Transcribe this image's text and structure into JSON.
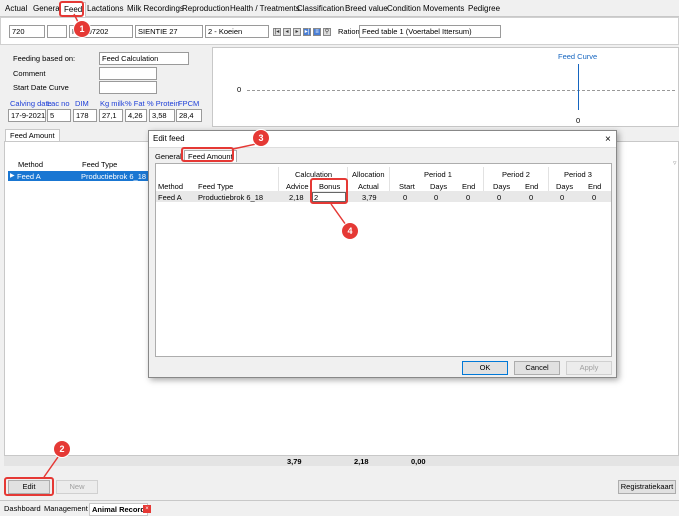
{
  "tabs": [
    "Actual",
    "General",
    "Feed",
    "Lactations",
    "Milk Recordings",
    "Reproduction",
    "Health / Treatments",
    "Classification",
    "Breed value",
    "Condition",
    "Movements",
    "Pedigree"
  ],
  "animal": {
    "number": "720",
    "id": "NL 207202",
    "name": "SIENTIE 27",
    "group": "2 - Koeien",
    "ration_label": "Ration",
    "ration": "Feed table 1 (Voertabel Ittersum)"
  },
  "feeding": {
    "based_on_label": "Feeding based on:",
    "based_on": "Feed Calculation",
    "comment_label": "Comment",
    "start_label": "Start Date Curve"
  },
  "lactation": {
    "headers": [
      "Calving date",
      "Lac no",
      "DIM",
      "Kg milk",
      "% Fat",
      "% Protein",
      "FPCM"
    ],
    "values": [
      "17-9-2021",
      "5",
      "178",
      "27,1",
      "4,26",
      "3,58",
      "28,4"
    ]
  },
  "curve": {
    "title": "Feed Curve",
    "y_label": "0",
    "x_label": "0"
  },
  "subtab": "Feed Amount",
  "grid": {
    "method_hdr": "Method",
    "feedtype_hdr": "Feed Type",
    "row_method": "Feed A",
    "row_type": "Productiebrok 6_18"
  },
  "footer": {
    "v1": "3,79",
    "v2": "2,18",
    "v3": "0,00"
  },
  "buttons": {
    "edit": "Edit",
    "new": "New",
    "registratiekaart": "Registratiekaart"
  },
  "bottom_tabs": [
    "Dashboard",
    "Management",
    "Animal Record"
  ],
  "dialog": {
    "title": "Edit feed",
    "tabs": [
      "General",
      "Feed Amount"
    ],
    "groups": {
      "calc": "Calculation",
      "alloc": "Allocation",
      "p1": "Period 1",
      "p2": "Period 2",
      "p3": "Period 3"
    },
    "cols": [
      "Method",
      "Feed Type",
      "Advice",
      "Bonus",
      "Actual",
      "Start",
      "Days",
      "End",
      "Days",
      "End",
      "Days",
      "End"
    ],
    "row": [
      "Feed A",
      "Productiebrok 6_18",
      "2,18",
      "2",
      "3,79",
      "0",
      "0",
      "0",
      "0",
      "0",
      "0",
      "0"
    ],
    "ok": "OK",
    "cancel": "Cancel",
    "apply": "Apply"
  },
  "callouts": [
    "1",
    "2",
    "3",
    "4"
  ]
}
